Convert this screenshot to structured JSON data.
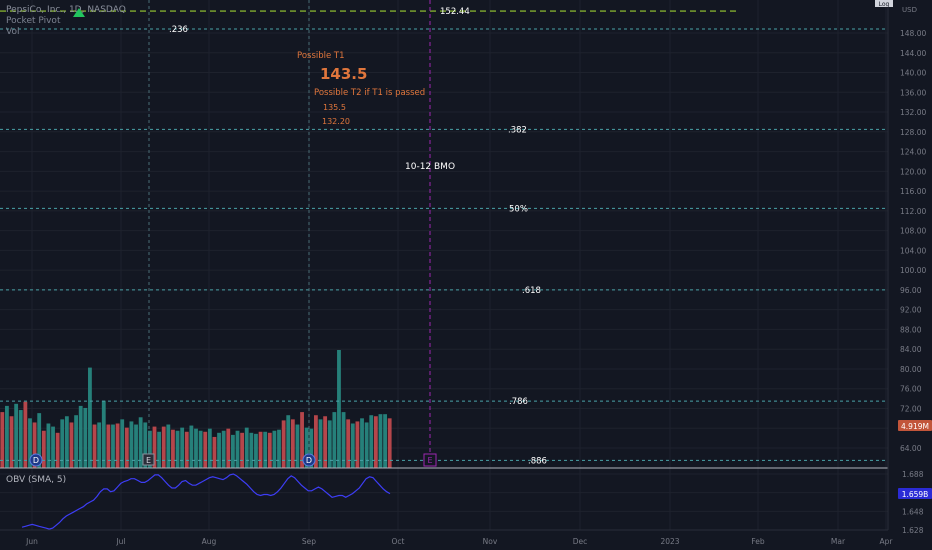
{
  "legend": {
    "symbol_line": "PepsiCo, Inc., 1D, NASDAQ",
    "indicator_1": "Pocket Pivot",
    "indicator_2": "Vol"
  },
  "top_right_tag": "Log",
  "currency": "USD",
  "obv_legend": "OBV (SMA, 5)",
  "colors": {
    "background": "#131722",
    "grid": "#1e222d",
    "fib_line": "#4aa3a8",
    "target_line": "#9acd32",
    "vol_up": "#26807a",
    "vol_down": "#b5464b",
    "obv_line": "#3d3df5",
    "annotation_orange": "#e0763c",
    "earnings_purple": "#9c27b0",
    "price_badge": "#c2553a",
    "obv_badge": "#2b2bd6"
  },
  "annotations": {
    "t1_label": "Possible T1",
    "t1_value": "143.5",
    "t2_label": "Possible T2 if T1 is passed",
    "t2_value_a": "135.5",
    "t2_value_b": "132.20",
    "bmo_label": "10-12 BMO"
  },
  "markers": {
    "dividend_1": "D",
    "earnings_1": "E",
    "dividend_2": "D",
    "earnings_future": "E"
  },
  "badges": {
    "price": "4.919M",
    "obv": "1.659B"
  },
  "chart_data": [
    {
      "type": "line",
      "title": "Fibonacci retracement levels",
      "yaxis_ticks": [
        "148.00",
        "144.00",
        "140.00",
        "136.00",
        "132.00",
        "128.00",
        "124.00",
        "120.00",
        "116.00",
        "112.00",
        "108.00",
        "104.00",
        "100.00",
        "96.00",
        "92.00",
        "88.00",
        "84.00",
        "80.00",
        "76.00",
        "72.00",
        "68.00",
        "64.00"
      ],
      "levels": [
        {
          "name": "152.44",
          "price": 152.44
        },
        {
          "name": ".236",
          "price": 148.8
        },
        {
          "name": ".382",
          "price": 128.5
        },
        {
          "name": "50%",
          "price": 112.5
        },
        {
          "name": ".618",
          "price": 96.0
        },
        {
          "name": ".786",
          "price": 73.5
        },
        {
          "name": ".886",
          "price": 61.5
        }
      ]
    },
    {
      "type": "bar",
      "title": "Vol",
      "x_ticks": [
        "Jun",
        "Jul",
        "Aug",
        "Sep",
        "Oct",
        "Nov",
        "Dec",
        "2023",
        "Feb",
        "Mar",
        "Apr"
      ],
      "values": [
        5.4,
        6.0,
        5.0,
        6.2,
        5.6,
        6.4,
        4.8,
        4.4,
        5.3,
        3.6,
        4.3,
        4.0,
        3.4,
        4.7,
        5.0,
        4.4,
        5.1,
        6.0,
        5.8,
        9.7,
        4.2,
        4.4,
        6.5,
        4.2,
        4.2,
        4.3,
        4.7,
        3.9,
        4.5,
        4.2,
        4.9,
        4.4,
        3.6,
        4.0,
        3.5,
        4.0,
        4.2,
        3.7,
        3.6,
        3.9,
        3.5,
        4.1,
        3.8,
        3.6,
        3.5,
        3.8,
        3.0,
        3.4,
        3.6,
        3.8,
        3.2,
        3.6,
        3.4,
        3.9,
        3.4,
        3.3,
        3.5,
        3.5,
        3.4,
        3.6,
        3.7,
        4.6,
        5.1,
        4.7,
        4.2,
        5.4,
        3.9,
        3.8,
        5.1,
        4.7,
        5.0,
        4.6,
        5.4,
        11.4,
        5.4,
        4.7,
        4.3,
        4.5,
        4.8,
        4.4,
        5.1,
        5.0,
        5.2,
        5.2,
        4.8
      ],
      "directions": [
        "down",
        "up",
        "down",
        "up",
        "up",
        "down",
        "up",
        "down",
        "up",
        "down",
        "up",
        "up",
        "down",
        "up",
        "up",
        "down",
        "up",
        "up",
        "up",
        "up",
        "down",
        "up",
        "up",
        "down",
        "up",
        "down",
        "up",
        "down",
        "up",
        "up",
        "up",
        "up",
        "up",
        "down",
        "up",
        "down",
        "up",
        "down",
        "up",
        "up",
        "down",
        "up",
        "up",
        "up",
        "down",
        "up",
        "down",
        "up",
        "up",
        "down",
        "up",
        "up",
        "down",
        "up",
        "up",
        "up",
        "down",
        "up",
        "down",
        "up",
        "up",
        "down",
        "up",
        "down",
        "up",
        "down",
        "up",
        "up",
        "down",
        "up",
        "down",
        "up",
        "up",
        "up",
        "up",
        "down",
        "up",
        "down",
        "up",
        "up",
        "up",
        "down",
        "up",
        "up",
        "down"
      ]
    },
    {
      "type": "line",
      "title": "OBV (SMA, 5)",
      "ylim": [
        1.62,
        1.69
      ],
      "yaxis_ticks": [
        "1.688",
        "1.668",
        "1.648",
        "1.628"
      ],
      "values": [
        1.631,
        1.632,
        1.633,
        1.634,
        1.633,
        1.632,
        1.631,
        1.63,
        1.629,
        1.63,
        1.633,
        1.636,
        1.64,
        1.643,
        1.645,
        1.647,
        1.649,
        1.651,
        1.653,
        1.656,
        1.658,
        1.66,
        1.664,
        1.669,
        1.672,
        1.672,
        1.669,
        1.67,
        1.674,
        1.678,
        1.68,
        1.681,
        1.683,
        1.683,
        1.681,
        1.679,
        1.679,
        1.681,
        1.684,
        1.687,
        1.687,
        1.684,
        1.68,
        1.676,
        1.673,
        1.673,
        1.676,
        1.68,
        1.681,
        1.678,
        1.676,
        1.676,
        1.678,
        1.68,
        1.682,
        1.684,
        1.685,
        1.684,
        1.683,
        1.682,
        1.684,
        1.687,
        1.688,
        1.686,
        1.683,
        1.68,
        1.677,
        1.673,
        1.669,
        1.666,
        1.665,
        1.666,
        1.666,
        1.665,
        1.666,
        1.669,
        1.673,
        1.678,
        1.683,
        1.686,
        1.684,
        1.68,
        1.676,
        1.673,
        1.67,
        1.67,
        1.672,
        1.674,
        1.672,
        1.669,
        1.666,
        1.663,
        1.664,
        1.665,
        1.665,
        1.663,
        1.665,
        1.667,
        1.67,
        1.673,
        1.678,
        1.683,
        1.685,
        1.684,
        1.68,
        1.676,
        1.672,
        1.669,
        1.667
      ]
    }
  ]
}
